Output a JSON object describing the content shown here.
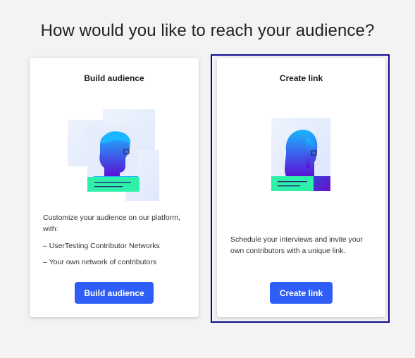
{
  "page": {
    "title": "How would you like to reach your audience?"
  },
  "cards": [
    {
      "title": "Build audience",
      "description": "Customize your audience on our platform, with:",
      "bullets": [
        "– UserTesting Contributor Networks",
        "– Your own network of contributors"
      ],
      "button_label": "Build audience",
      "illustration_icon": "person-group-icon",
      "selected": false
    },
    {
      "title": "Create link",
      "description": "Schedule your interviews and invite your own contributors with a unique link.",
      "button_label": "Create link",
      "illustration_icon": "person-portrait-icon",
      "selected": true
    }
  ],
  "colors": {
    "background": "#f3f3f3",
    "card": "#ffffff",
    "button": "#2e5ef5",
    "selection_border": "#100c8c",
    "illustration_green": "#2ef0a8",
    "illustration_gradient_start": "#1ab6ff",
    "illustration_gradient_end": "#5a12d6"
  }
}
